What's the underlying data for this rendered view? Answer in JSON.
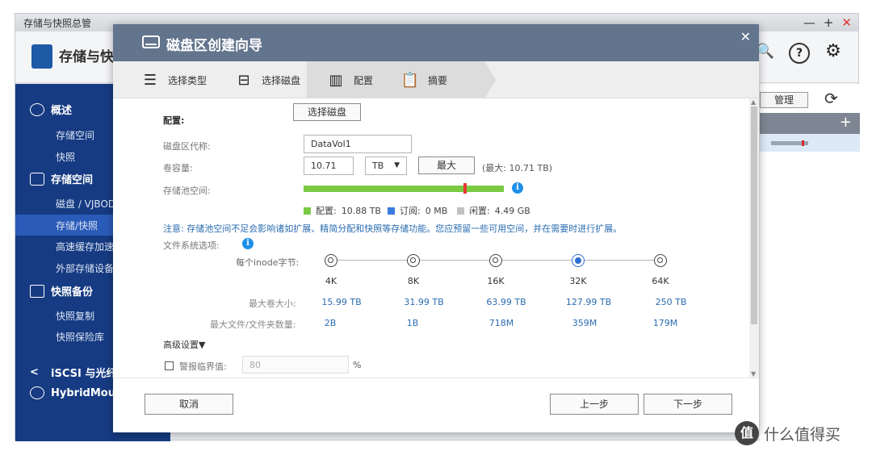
{
  "bg_window": {
    "title": "存储与快照总管",
    "app_name": "存储与快照",
    "controls": [
      "—",
      "+",
      "✕"
    ],
    "header_icons": [
      "🔍",
      "?",
      "⚙"
    ],
    "sidebar": {
      "groups": [
        {
          "label": "概述",
          "items": [
            "存储空间",
            "快照"
          ]
        },
        {
          "label": "存储空间",
          "items": [
            "磁盘 / VJBOD",
            "存储/快照",
            "高速缓存加速",
            "外部存储设备"
          ]
        },
        {
          "label": "快照备份",
          "items": [
            "快照复制",
            "快照保险库"
          ]
        },
        {
          "label": "iSCSI 与光纤通",
          "items": []
        },
        {
          "label": "HybridMount",
          "items": []
        }
      ],
      "active_item": "存储/快照"
    },
    "right_panel": {
      "manage_label": "管理",
      "refresh_icon": "refresh-icon",
      "add_icon": "plus-icon"
    }
  },
  "dialog": {
    "title": "磁盘区创建向导",
    "close_icon": "✕",
    "steps": [
      {
        "label": "选择类型",
        "icon": "list-icon"
      },
      {
        "label": "选择磁盘",
        "icon": "disk-icon"
      },
      {
        "label": "配置",
        "icon": "config-icon",
        "active": true
      },
      {
        "label": "摘要",
        "icon": "clipboard-icon"
      }
    ],
    "config": {
      "section_label": "配置:",
      "select_disk_button": "选择磁盘",
      "volume_alias_label": "磁盘区代称:",
      "volume_alias_value": "DataVol1",
      "capacity_label": "卷容量:",
      "capacity_value": "10.71",
      "capacity_unit": "TB",
      "max_button": "最大",
      "max_hint": "(最大:  10.71 TB)",
      "pool_space_label": "存储池空间:",
      "pool": {
        "configured_label": "配置:",
        "configured_value": "10.88 TB",
        "subscribed_label": "订阅:",
        "subscribed_value": "0 MB",
        "free_label": "闲置:",
        "free_value": "4.49 GB",
        "used_fraction": 0.8,
        "colors": {
          "configured": "#7ac943",
          "subscribed": "#3b7be0",
          "free": "#c0c0c0",
          "marker": "#e53935"
        }
      },
      "note": "注意: 存储池空间不足会影响诸如扩展、精简分配和快照等存储功能。您应预留一些可用空间，并在需要时进行扩展。",
      "fs_options_label": "文件系统选项:",
      "bytes_per_inode_label": "每个inode字节:",
      "inode_options": [
        "4K",
        "8K",
        "16K",
        "32K",
        "64K"
      ],
      "selected_inode": "32K",
      "max_volume_label": "最大卷大小:",
      "max_volume_values": [
        "15.99 TB",
        "31.99 TB",
        "63.99 TB",
        "127.99 TB",
        "250 TB"
      ],
      "max_files_label": "最大文件/文件夹数量:",
      "max_files_values": [
        "2B",
        "1B",
        "718M",
        "359M",
        "179M"
      ],
      "advanced_label": "高级设置▼",
      "alert_threshold_label": "警报临界值:",
      "alert_threshold_value": "80",
      "alert_threshold_unit": "%"
    },
    "buttons": {
      "cancel": "取消",
      "prev": "上一步",
      "next": "下一步"
    }
  },
  "watermark": {
    "logo": "值",
    "text": "什么值得买"
  }
}
